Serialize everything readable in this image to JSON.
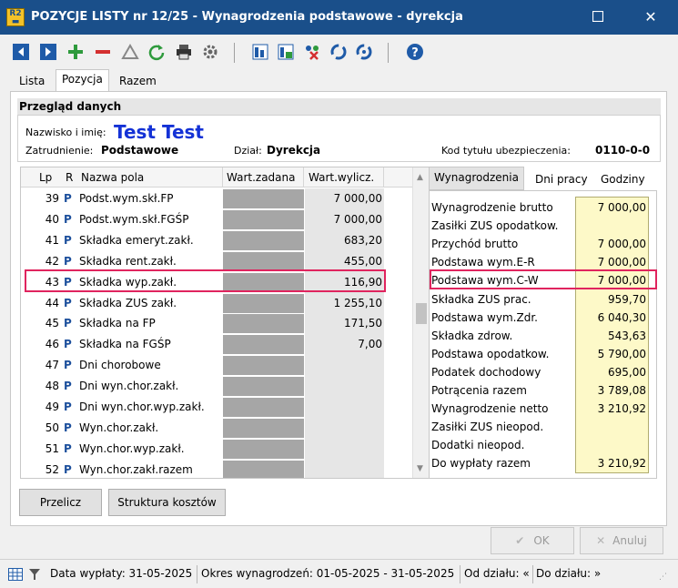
{
  "window": {
    "title": "POZYCJE LISTY nr 12/25 - Wynagrodzenia podstawowe - dyrekcja",
    "app_icon": "R2 Płace",
    "minimize": "☐",
    "close": "✕"
  },
  "tabs": [
    "Lista",
    "Pozycja",
    "Razem"
  ],
  "section_title": "Przegląd danych",
  "employee": {
    "name_label": "Nazwisko i imię:",
    "name": "Test Test",
    "employment_label": "Zatrudnienie:",
    "employment": "Podstawowe",
    "dept_label": "Dział:",
    "dept": "Dyrekcja",
    "insurance_label": "Kod tytułu ubezpieczenia:",
    "insurance": "0110-0-0"
  },
  "grid": {
    "headers": [
      "Lp",
      "R",
      "Nazwa pola",
      "Wart.zadana",
      "Wart.wylicz."
    ],
    "rows": [
      {
        "lp": "39",
        "r": "P",
        "name": "Podst.wym.skł.FP",
        "value": "7 000,00"
      },
      {
        "lp": "40",
        "r": "P",
        "name": "Podst.wym.skł.FGŚP",
        "value": "7 000,00"
      },
      {
        "lp": "41",
        "r": "P",
        "name": "Składka emeryt.zakł.",
        "value": "683,20"
      },
      {
        "lp": "42",
        "r": "P",
        "name": "Składka rent.zakł.",
        "value": "455,00"
      },
      {
        "lp": "43",
        "r": "P",
        "name": "Składka wyp.zakł.",
        "value": "116,90"
      },
      {
        "lp": "44",
        "r": "P",
        "name": "Składka ZUS zakł.",
        "value": "1 255,10"
      },
      {
        "lp": "45",
        "r": "P",
        "name": "Składka na FP",
        "value": "171,50"
      },
      {
        "lp": "46",
        "r": "P",
        "name": "Składka na FGŚP",
        "value": "7,00"
      },
      {
        "lp": "47",
        "r": "P",
        "name": "Dni chorobowe",
        "value": ""
      },
      {
        "lp": "48",
        "r": "P",
        "name": "Dni wyn.chor.zakł.",
        "value": ""
      },
      {
        "lp": "49",
        "r": "P",
        "name": "Dni wyn.chor.wyp.zakł.",
        "value": ""
      },
      {
        "lp": "50",
        "r": "P",
        "name": "Wyn.chor.zakł.",
        "value": ""
      },
      {
        "lp": "51",
        "r": "P",
        "name": "Wyn.chor.wyp.zakł.",
        "value": ""
      },
      {
        "lp": "52",
        "r": "P",
        "name": "Wyn.chor.zakł.razem",
        "value": ""
      }
    ]
  },
  "right_tabs": [
    "Wynagrodzenia",
    "Dni pracy",
    "Godziny"
  ],
  "summary": [
    {
      "label": "Wynagrodzenie brutto",
      "value": "7 000,00"
    },
    {
      "label": "Zasiłki ZUS opodatkow.",
      "value": ""
    },
    {
      "label": "Przychód brutto",
      "value": "7 000,00"
    },
    {
      "label": "Podstawa wym.E-R",
      "value": "7 000,00"
    },
    {
      "label": "Podstawa wym.C-W",
      "value": "7 000,00"
    },
    {
      "label": "Składka ZUS prac.",
      "value": "959,70"
    },
    {
      "label": "Podstawa wym.Zdr.",
      "value": "6 040,30"
    },
    {
      "label": "Składka zdrow.",
      "value": "543,63"
    },
    {
      "label": "Podstawa opodatkow.",
      "value": "5 790,00"
    },
    {
      "label": "Podatek dochodowy",
      "value": "695,00"
    },
    {
      "label": "Potrącenia razem",
      "value": "3 789,08"
    },
    {
      "label": "Wynagrodzenie netto",
      "value": "3 210,92"
    },
    {
      "label": "Zasiłki ZUS nieopod.",
      "value": ""
    },
    {
      "label": "Dodatki nieopod.",
      "value": ""
    },
    {
      "label": "Do wypłaty razem",
      "value": "3 210,92"
    }
  ],
  "buttons": {
    "calc": "Przelicz",
    "cost_structure": "Struktura kosztów",
    "ok": "OK",
    "cancel": "Anuluj"
  },
  "status": {
    "pay_date": "Data wypłaty: 31-05-2025",
    "period": "Okres wynagrodzeń: 01-05-2025 - 31-05-2025",
    "from_dept": "Od działu: «",
    "to_dept": "Do działu: »"
  },
  "colors": {
    "titlebar": "#1a4f8a",
    "highlight": "#e0245e",
    "name": "#1432d6",
    "summary_bg": "#fdf9c8"
  }
}
